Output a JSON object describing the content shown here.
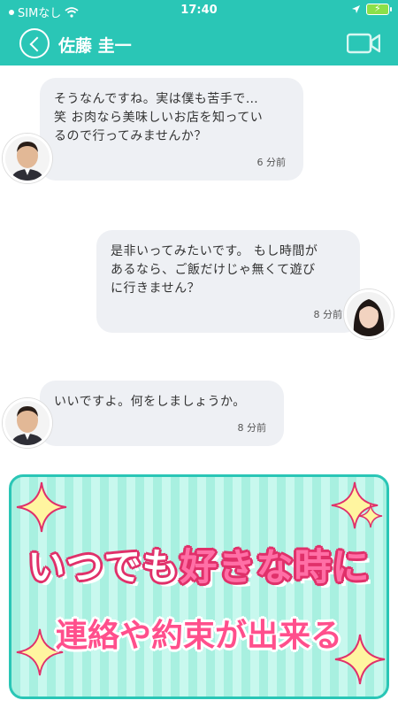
{
  "status_bar": {
    "carrier": "SIMなし",
    "time": "17:40"
  },
  "header": {
    "contact_name": "佐藤 圭一"
  },
  "messages": [
    {
      "side": "left",
      "text": "そうなんですね。実は僕も苦手で…\n笑 お肉なら美味しいお店を知ってい\nるので行ってみませんか？",
      "time": "6 分前"
    },
    {
      "side": "right",
      "text": "是非いってみたいです。 もし時間が\nあるなら、ご飯だけじゃ無くて遊び\nに行きません？",
      "time": "8 分前"
    },
    {
      "side": "left",
      "text": "いいですよ。何をしましょうか。",
      "time": "8 分前"
    }
  ],
  "banner": {
    "line1_prefix": "いつでも",
    "line1_highlight": "好きな時に",
    "line2": "連絡や約束が出来る"
  },
  "colors": {
    "accent": "#2ac6b6",
    "bubble": "#eef0f4",
    "pink": "#e0306a"
  }
}
